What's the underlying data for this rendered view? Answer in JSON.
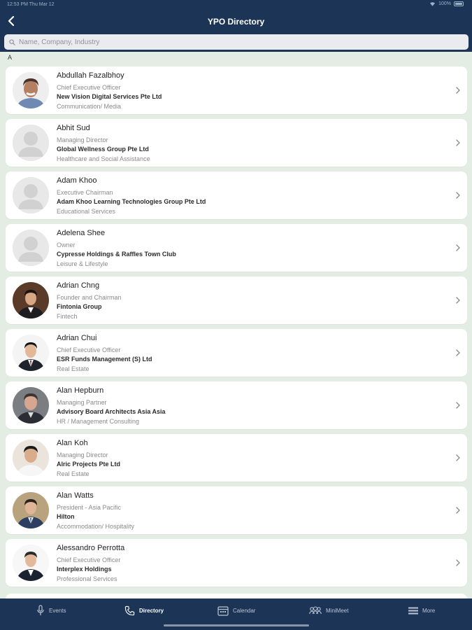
{
  "status_bar": {
    "time": "12:53 PM  Thu Mar 12",
    "battery": "100%"
  },
  "header": {
    "title": "YPO Directory"
  },
  "search": {
    "placeholder": "Name, Company, Industry"
  },
  "section": {
    "letter": "A"
  },
  "members": [
    {
      "name": "Abdullah Fazalbhoy",
      "title": "Chief Executive Officer",
      "company": "New Vision Digital Services Pte Ltd",
      "industry": "Communication/ Media",
      "photo": true
    },
    {
      "name": "Abhit Sud",
      "title": "Managing Director",
      "company": "Global Wellness Group Pte Ltd",
      "industry": "Healthcare and Social Assistance",
      "photo": false
    },
    {
      "name": "Adam Khoo",
      "title": "Executive Chairman",
      "company": "Adam Khoo Learning Technologies Group Pte Ltd",
      "industry": "Educational Services",
      "photo": false
    },
    {
      "name": "Adelena Shee",
      "title": "Owner",
      "company": "Cypresse Holdings & Raffles Town Club",
      "industry": "Leisure & Lifestyle",
      "photo": false
    },
    {
      "name": "Adrian Chng",
      "title": "Founder and Chairman",
      "company": "Fintonia Group",
      "industry": "Fintech",
      "photo": true
    },
    {
      "name": "Adrian Chui",
      "title": "Chief Executive Officer",
      "company": "ESR Funds Management (S) Ltd",
      "industry": "Real Estate",
      "photo": true
    },
    {
      "name": "Alan Hepburn",
      "title": "Managing Partner",
      "company": "Advisory Board Architects Asia Asia",
      "industry": "HR / Management Consulting",
      "photo": true
    },
    {
      "name": "Alan Koh",
      "title": "Managing Director",
      "company": "Alric Projects Pte Ltd",
      "industry": "Real Estate",
      "photo": true
    },
    {
      "name": "Alan Watts",
      "title": "President - Asia Pacific",
      "company": "Hilton",
      "industry": "Accommodation/ Hospitality",
      "photo": true
    },
    {
      "name": "Alessandro Perrotta",
      "title": "Chief Executive Officer",
      "company": "Interplex Holdings",
      "industry": "Professional Services",
      "photo": true
    }
  ],
  "tabs": [
    {
      "label": "Events",
      "icon": "microphone-icon",
      "active": false
    },
    {
      "label": "Directory",
      "icon": "phone-icon",
      "active": true
    },
    {
      "label": "Calendar",
      "icon": "calendar-icon",
      "active": false
    },
    {
      "label": "MiniMeet",
      "icon": "group-icon",
      "active": false
    },
    {
      "label": "More",
      "icon": "menu-icon",
      "active": false
    }
  ],
  "colors": {
    "navy": "#1c3557",
    "background": "#e4ede3",
    "card": "#ffffff"
  }
}
